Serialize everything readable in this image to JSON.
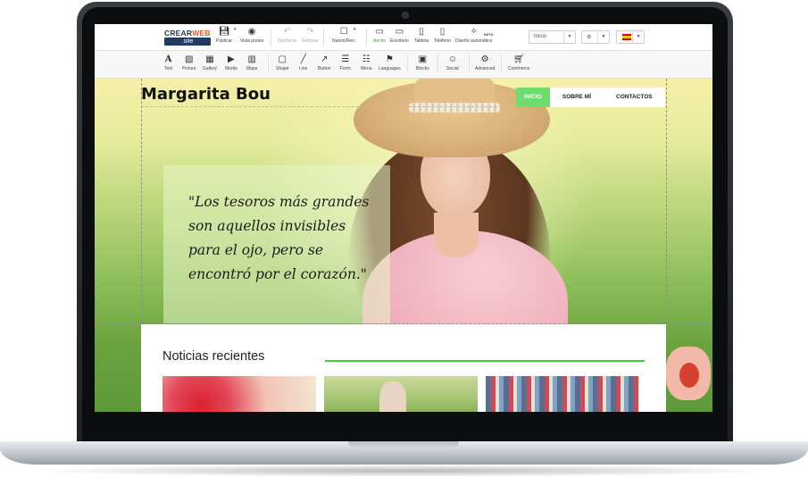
{
  "editor": {
    "logo": {
      "top_a": "CREAR",
      "top_b": "WEB",
      "bottom": ".site"
    },
    "toolbar_main": [
      {
        "label": "Publicar",
        "icon": "save-icon"
      },
      {
        "label": "Vista previa",
        "icon": "eye-icon"
      },
      {
        "label": "Deshacer",
        "icon": "undo-icon"
      },
      {
        "label": "Rehacer",
        "icon": "redo-icon"
      },
      {
        "label": "Nuevo/Ren.",
        "icon": "page-icon"
      },
      {
        "label": "Ancho",
        "icon": "monitor-icon"
      },
      {
        "label": "Escritorio",
        "icon": "laptop-icon"
      },
      {
        "label": "Tableta",
        "icon": "tablet-icon"
      },
      {
        "label": "Teléfono",
        "icon": "phone-icon"
      },
      {
        "label": "Diseño automático",
        "icon": "magic-wand-icon",
        "badge": "BETA"
      }
    ],
    "page_select": "Inicio",
    "toolbar_insert": [
      {
        "label": "Text",
        "icon": "text-icon"
      },
      {
        "label": "Picture",
        "icon": "picture-icon"
      },
      {
        "label": "Gallery",
        "icon": "gallery-icon"
      },
      {
        "label": "Media",
        "icon": "media-icon"
      },
      {
        "label": "Maps",
        "icon": "map-icon"
      },
      {
        "label": "Shape",
        "icon": "shape-icon"
      },
      {
        "label": "Line",
        "icon": "line-icon"
      },
      {
        "label": "Button",
        "icon": "button-icon"
      },
      {
        "label": "Form",
        "icon": "form-icon"
      },
      {
        "label": "Menu",
        "icon": "menu-icon"
      },
      {
        "label": "Languages",
        "icon": "languages-icon"
      },
      {
        "label": "Blocks",
        "icon": "blocks-icon"
      },
      {
        "label": "Social",
        "icon": "social-icon"
      },
      {
        "label": "Advanced",
        "icon": "advanced-icon"
      },
      {
        "label": "Commerce",
        "icon": "cart-icon"
      }
    ]
  },
  "site": {
    "title": "Margarita Bou",
    "nav": [
      "INICIO",
      "SOBRE MÍ",
      "CONTACTOS"
    ],
    "quote": "\"Los tesoros más grandes son aquellos invisibles para el ojo, pero se encontró por el corazón.\"",
    "news_heading": "Noticias recientes",
    "accent_color": "#6fdc6f"
  }
}
